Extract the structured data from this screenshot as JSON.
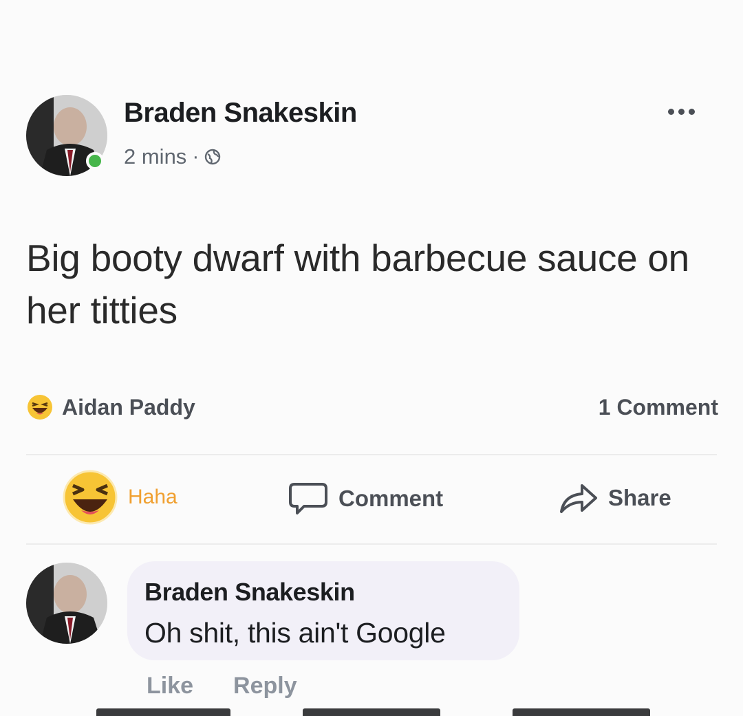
{
  "post": {
    "author": "Braden Snakeskin",
    "time": "2 mins",
    "separator": "·",
    "privacy_icon": "globe-icon",
    "text": "Big booty dwarf with barbecue sauce on her titties"
  },
  "reactions": {
    "reaction_icon": "haha-emoji-icon",
    "reactor": "Aidan Paddy",
    "comment_count": "1 Comment"
  },
  "actions": {
    "haha": "Haha",
    "comment": "Comment",
    "share": "Share"
  },
  "comment": {
    "author": "Braden Snakeskin",
    "text": "Oh shit, this ain't Google",
    "like": "Like",
    "reply": "Reply"
  },
  "colors": {
    "online": "#46b64a",
    "haha": "#f0a030",
    "comment_bubble": "#f2f0f8"
  }
}
